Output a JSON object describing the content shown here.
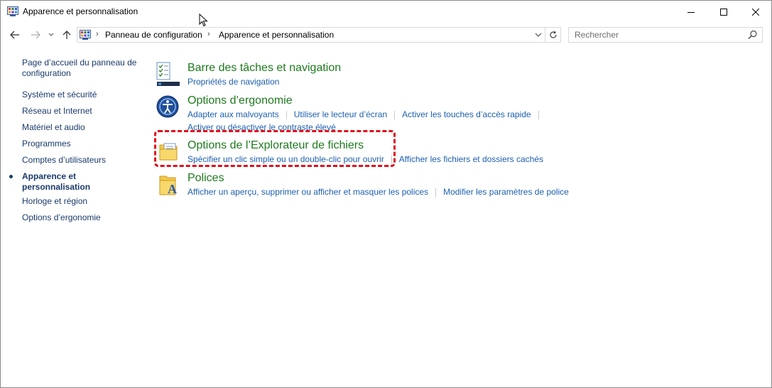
{
  "window": {
    "title": "Apparence et personnalisation"
  },
  "address_bar": {
    "breadcrumbs": [
      "Panneau de configuration",
      "Apparence et personnalisation"
    ]
  },
  "search": {
    "placeholder": "Rechercher"
  },
  "left_nav": {
    "items": [
      {
        "label_line1": "Page d’accueil du panneau de",
        "label_line2": "configuration"
      },
      {
        "label": "Système et sécurité"
      },
      {
        "label": "Réseau et Internet"
      },
      {
        "label": "Matériel et audio"
      },
      {
        "label": "Programmes"
      },
      {
        "label": "Comptes d’utilisateurs"
      },
      {
        "label_line1": "Apparence et",
        "label_line2": "personnalisation",
        "current": true
      },
      {
        "label": "Horloge et région"
      },
      {
        "label": "Options d’ergonomie"
      }
    ]
  },
  "categories": [
    {
      "title": "Barre des tâches et navigation",
      "icon": "taskbar-icon",
      "links": [
        "Propriétés de navigation"
      ]
    },
    {
      "title": "Options d’ergonomie",
      "icon": "ease-of-access-icon",
      "links": [
        "Adapter aux malvoyants",
        "Utiliser le lecteur d’écran",
        "Activer les touches d’accès rapide",
        "Activer ou désactiver le contraste élevé"
      ]
    },
    {
      "title": "Options de l’Explorateur de fichiers",
      "icon": "folder-options-icon",
      "links": [
        "Spécifier un clic simple ou un double-clic pour ouvrir",
        "Afficher les fichiers et dossiers cachés"
      ]
    },
    {
      "title": "Polices",
      "icon": "fonts-folder-icon",
      "links": [
        "Afficher un aperçu, supprimer ou afficher et masquer les polices",
        "Modifier les paramètres de police"
      ]
    }
  ],
  "colors": {
    "category_title": "#1e7a1e",
    "link": "#1c5fb0",
    "highlight": "#e0101a"
  }
}
